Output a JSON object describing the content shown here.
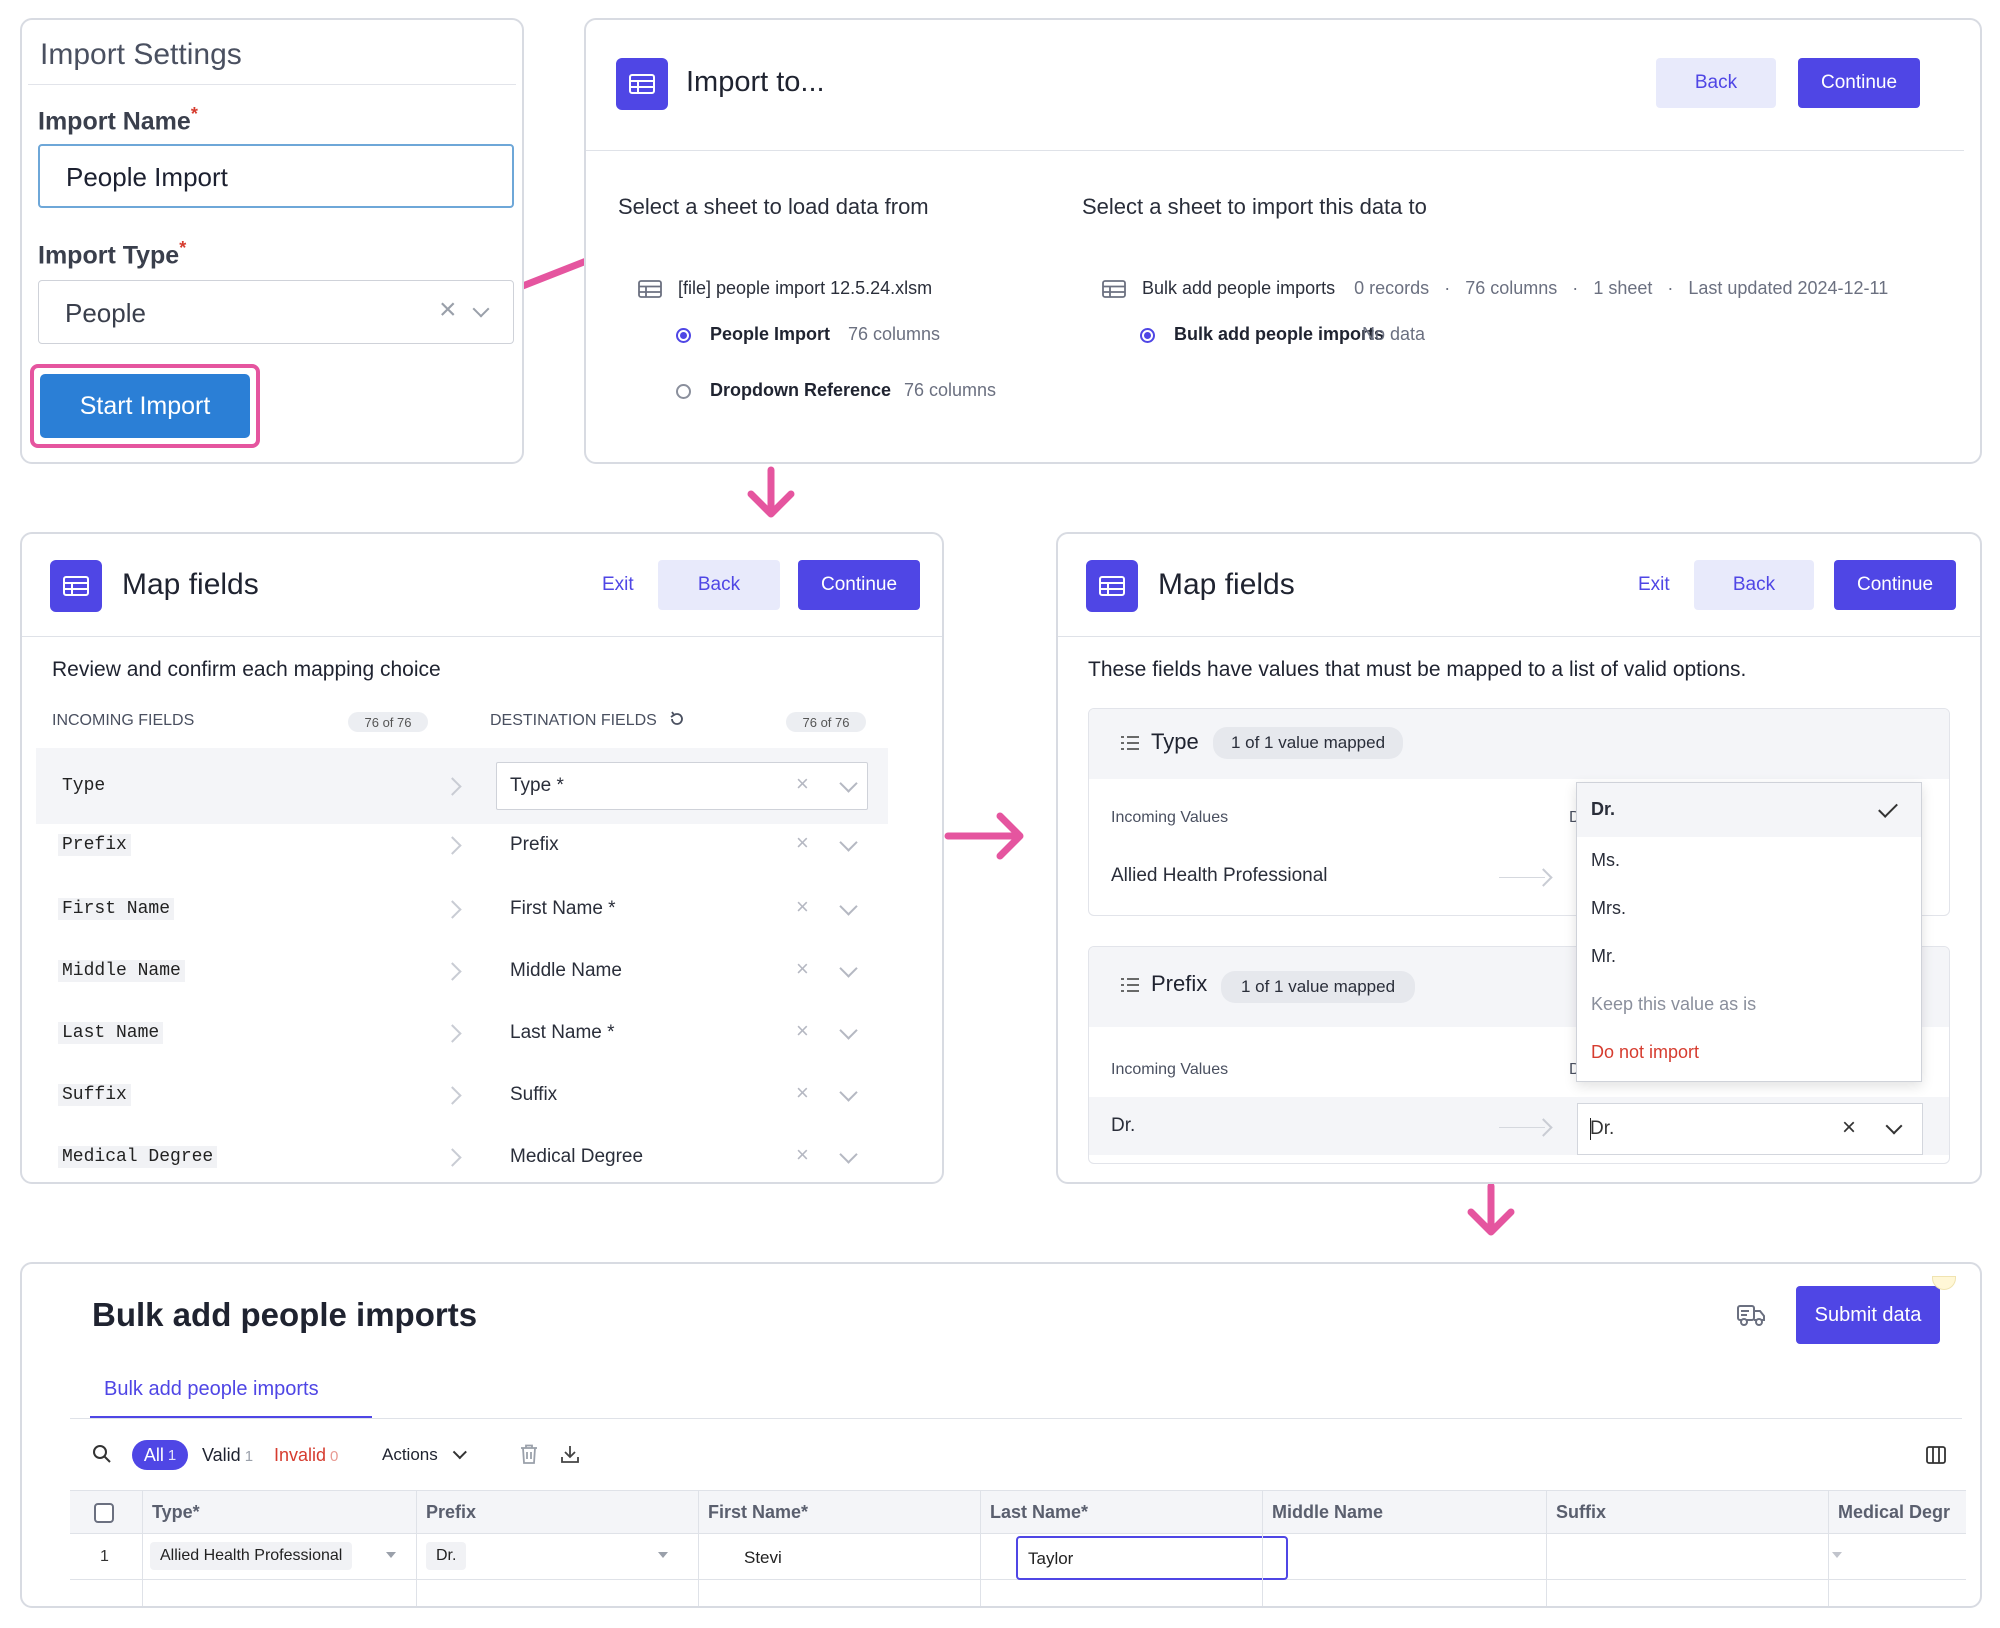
{
  "settings": {
    "heading": "Import Settings",
    "name_label": "Import Name",
    "required_mark": "*",
    "name_value": "People Import",
    "type_label": "Import Type",
    "type_value": "People",
    "clear_mark": "×",
    "start_button": "Start Import"
  },
  "import_to": {
    "title": "Import to...",
    "back": "Back",
    "continue": "Continue",
    "left_heading": "Select a sheet to load data from",
    "file_name": "[file] people import 12.5.24.xlsm",
    "sheets": [
      {
        "name": "People Import",
        "meta": "76 columns",
        "selected": true
      },
      {
        "name": "Dropdown Reference",
        "meta": "76 columns",
        "selected": false
      }
    ],
    "right_heading": "Select a sheet to import this data to",
    "dest_workbook": "Bulk add people imports",
    "dest_records": "0 records",
    "dest_columns": "76 columns",
    "dest_sheets": "1 sheet",
    "dest_updated": "Last updated 2024-12-11",
    "dot": "·",
    "dest_sheet_name": "Bulk add people imports",
    "dest_sheet_meta": "No data"
  },
  "map_fields_1": {
    "title": "Map fields",
    "exit": "Exit",
    "back": "Back",
    "continue": "Continue",
    "subtitle": "Review and confirm each mapping choice",
    "incoming_header": "INCOMING FIELDS",
    "incoming_count": "76 of 76",
    "destination_header": "DESTINATION FIELDS",
    "destination_count": "76 of 76",
    "rows": [
      {
        "incoming": "Type",
        "destination": "Type *"
      },
      {
        "incoming": "Prefix",
        "destination": "Prefix"
      },
      {
        "incoming": "First Name",
        "destination": "First Name *"
      },
      {
        "incoming": "Middle Name",
        "destination": "Middle Name"
      },
      {
        "incoming": "Last Name",
        "destination": "Last Name *"
      },
      {
        "incoming": "Suffix",
        "destination": "Suffix"
      },
      {
        "incoming": "Medical Degree",
        "destination": "Medical Degree"
      }
    ]
  },
  "map_fields_2": {
    "title": "Map fields",
    "exit": "Exit",
    "back": "Back",
    "continue": "Continue",
    "subtitle": "These fields have values that must be mapped to a list of valid options.",
    "type_group": {
      "name": "Type",
      "badge": "1 of 1 value mapped",
      "incoming_label": "Incoming Values",
      "incoming_value": "Allied Health Professional",
      "dest_label_fragment": "D"
    },
    "prefix_group": {
      "name": "Prefix",
      "badge": "1 of 1 value mapped",
      "incoming_label": "Incoming Values",
      "incoming_value": "Dr.",
      "dest_label_fragment": "D",
      "select_value": "Dr."
    },
    "dropdown": [
      {
        "label": "Dr.",
        "selected": true
      },
      {
        "label": "Ms."
      },
      {
        "label": "Mrs."
      },
      {
        "label": "Mr."
      },
      {
        "label": "Keep this value as is"
      },
      {
        "label": "Do not import"
      }
    ]
  },
  "bulk": {
    "title": "Bulk add people imports",
    "submit": "Submit data",
    "tab": "Bulk add people imports",
    "filter_all": "All",
    "filter_all_count": "1",
    "filter_valid": "Valid",
    "filter_valid_count": "1",
    "filter_invalid": "Invalid",
    "filter_invalid_count": "0",
    "actions": "Actions",
    "columns": [
      "Type*",
      "Prefix",
      "First Name*",
      "Last Name*",
      "Middle Name",
      "Suffix",
      "Medical Degr"
    ],
    "row": {
      "index": "1",
      "type": "Allied Health Professional",
      "prefix": "Dr.",
      "first_name": "Stevi",
      "last_name": "Taylor",
      "middle_name": "",
      "suffix": ""
    }
  },
  "colors": {
    "accent": "#4f46e5",
    "arrow": "#e5559f",
    "start_button": "#2b7fd6",
    "danger": "#d63c2f"
  },
  "icons": [
    "table-icon",
    "check-icon",
    "list-icon",
    "search-icon",
    "trash-icon",
    "download-icon",
    "columns-icon",
    "truck-icon",
    "refresh-icon"
  ]
}
